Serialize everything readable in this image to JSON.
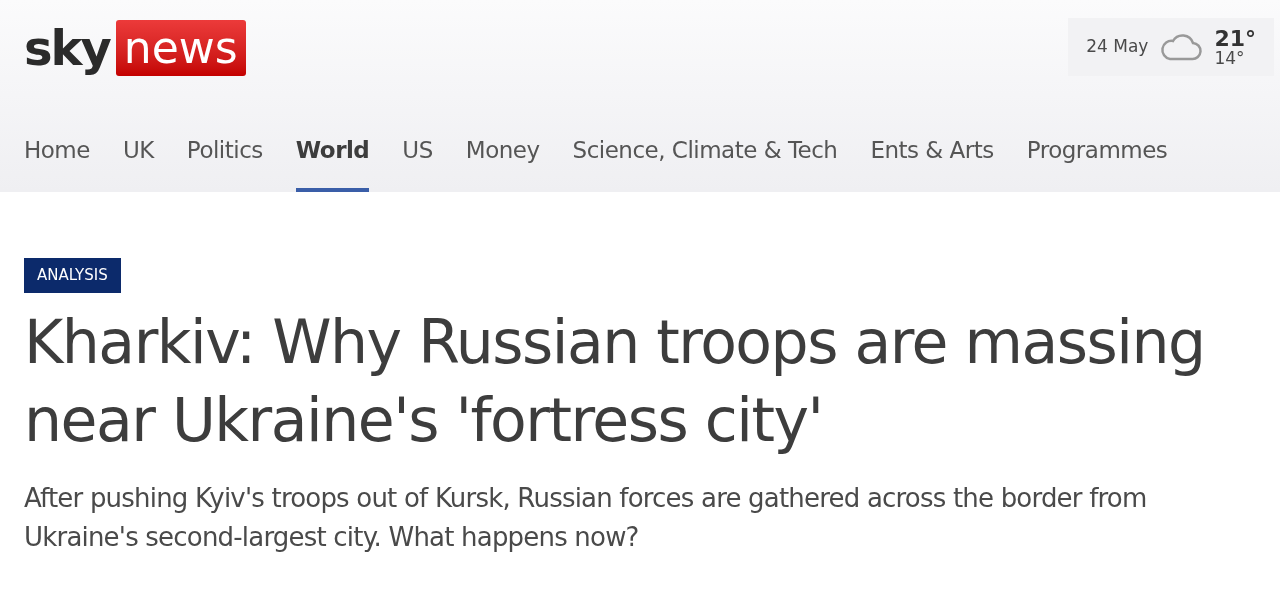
{
  "logo": {
    "brand": "sky",
    "product": "news"
  },
  "weather": {
    "date": "24 May",
    "high": "21°",
    "low": "14°"
  },
  "nav": [
    {
      "label": "Home",
      "selected": false
    },
    {
      "label": "UK",
      "selected": false
    },
    {
      "label": "Politics",
      "selected": false
    },
    {
      "label": "World",
      "selected": true
    },
    {
      "label": "US",
      "selected": false
    },
    {
      "label": "Money",
      "selected": false
    },
    {
      "label": "Science, Climate & Tech",
      "selected": false
    },
    {
      "label": "Ents & Arts",
      "selected": false
    },
    {
      "label": "Programmes",
      "selected": false
    }
  ],
  "article": {
    "label": "ANALYSIS",
    "headline": "Kharkiv: Why Russian troops are massing near Ukraine's 'fortress city'",
    "standfirst": "After pushing Kyiv's troops out of Kursk, Russian forces are gathered across the border from Ukraine's second-largest city. What happens now?"
  }
}
